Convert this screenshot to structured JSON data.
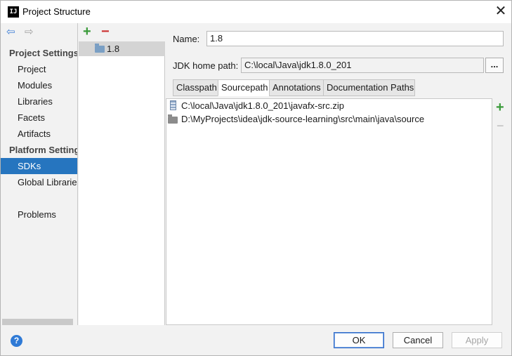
{
  "window": {
    "title": "Project Structure",
    "app_icon_text": "IJ"
  },
  "nav": {
    "back_icon": "back-arrow-icon",
    "forward_icon": "forward-arrow-icon",
    "sections": [
      {
        "label": "Project Settings"
      },
      {
        "label": "Platform Settings"
      }
    ],
    "project_items": [
      "Project",
      "Modules",
      "Libraries",
      "Facets",
      "Artifacts"
    ],
    "platform_items": [
      "SDKs",
      "Global Libraries"
    ],
    "problems": "Problems",
    "selected": "SDKs"
  },
  "sdk_list": {
    "items": [
      "1.8"
    ]
  },
  "form": {
    "name_label": "Name:",
    "name_value": "1.8",
    "home_label": "JDK home path:",
    "home_value": "C:\\local\\Java\\jdk1.8.0_201",
    "browse_label": "..."
  },
  "tabs": [
    "Classpath",
    "Sourcepath",
    "Annotations",
    "Documentation Paths"
  ],
  "active_tab": "Sourcepath",
  "paths": [
    "C:\\local\\Java\\jdk1.8.0_201\\javafx-src.zip",
    "D:\\MyProjects\\idea\\jdk-source-learning\\src\\main\\java\\source"
  ],
  "buttons": {
    "ok": "OK",
    "cancel": "Cancel",
    "apply": "Apply",
    "help": "?"
  },
  "colors": {
    "selection": "#2675bf",
    "add": "#3a9b3a",
    "remove": "#cc3333",
    "accent": "#2f7ad6"
  }
}
